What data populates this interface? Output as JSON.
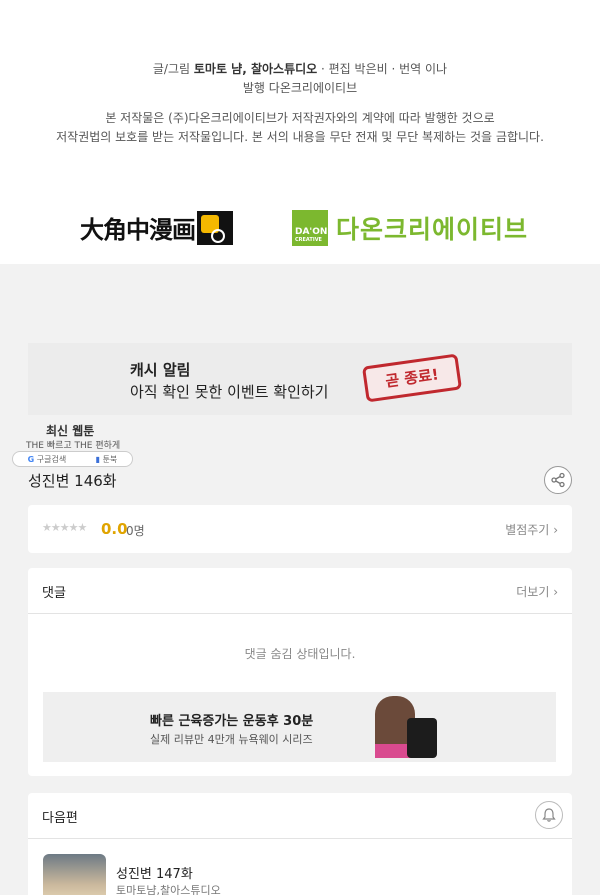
{
  "credits": {
    "line1_a": "글/그림 ",
    "line1_b": "토마토 냠, 찰아스튜디오",
    "line1_c": " · 편집 박은비 · 번역 이나",
    "line2": "발행 다온크리에이티브",
    "line3": "본 저작물은 (주)다온크리에이티브가 저작권자와의 계약에 따라 발행한 것으로",
    "line4": "저작권법의 보호를 받는 저작물입니다. 본 서의 내용을 무단 전재 및 무단 복제하는 것을 금합니다."
  },
  "logos": {
    "daewon": "大角中漫画",
    "daon_box_top": "DA'ON",
    "daon_box_bottom": "CREATIVE",
    "daon_text": "다온크리에이티브"
  },
  "cash_banner": {
    "title": "캐시 알림",
    "subtitle": "아직 확인 못한 이벤트 확인하기",
    "stamp": "곧 종료!"
  },
  "webtoon_logo": {
    "title": "최신 웹툰",
    "tagline": "THE 빠르고 THE 편하게",
    "left": "구글검색",
    "right": "툰북"
  },
  "episode": {
    "title": "성진변 146화"
  },
  "rating": {
    "stars": "★★★★★",
    "score": "0.0",
    "count": "0명",
    "rate_button": "별점주기"
  },
  "comments": {
    "header": "댓글",
    "more": "더보기",
    "hidden_message": "댓글 숨김 상태입니다."
  },
  "ad": {
    "headline": "빠른 근육증가는 운동후 30분",
    "subline": "실제 리뷰만 4만개 뉴욕웨이 시리즈"
  },
  "next_episode": {
    "header": "다음편",
    "title": "성진변 147화",
    "author": "토마토냠,찰아스튜디오"
  },
  "colors": {
    "accent_green": "#7cb82f",
    "score_yellow": "#e0a400",
    "stamp_red": "#c0282e"
  }
}
